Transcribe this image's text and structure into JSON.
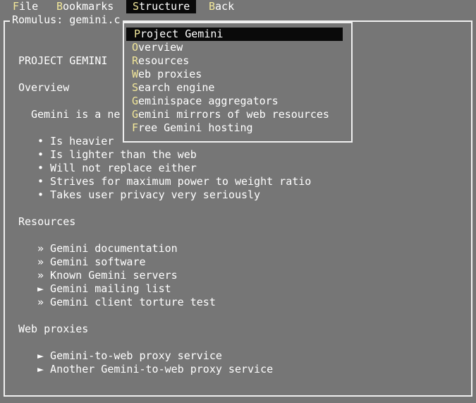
{
  "menubar": [
    {
      "label": "File",
      "hotkey": "F",
      "rest": "ile",
      "active": false
    },
    {
      "label": "Bookmarks",
      "hotkey": "B",
      "rest": "ookmarks",
      "active": false
    },
    {
      "label": "Structure",
      "hotkey": "S",
      "rest": "tructure",
      "active": true
    },
    {
      "label": "Back",
      "hotkey": "B",
      "rest": "ack",
      "active": false
    }
  ],
  "window": {
    "title": "Romulus: gemini.c"
  },
  "content": {
    "heading": "PROJECT GEMINI",
    "section_overview": "Overview",
    "intro": "Gemini is a ne",
    "overview_bullets": [
      "• Is heavier",
      "• Is lighter than the web",
      "• Will not replace either",
      "• Strives for maximum power to weight ratio",
      "• Takes user privacy very seriously"
    ],
    "section_resources": "Resources",
    "resource_links": [
      "» Gemini documentation",
      "» Gemini software",
      "» Known Gemini servers",
      "► Gemini mailing list",
      "» Gemini client torture test"
    ],
    "section_proxies": "Web proxies",
    "proxy_links": [
      "► Gemini-to-web proxy service",
      "► Another Gemini-to-web proxy service"
    ]
  },
  "structure_menu": {
    "items": [
      {
        "hotkey": "P",
        "rest": "roject Gemini",
        "selected": true
      },
      {
        "hotkey": "O",
        "rest": "verview",
        "selected": false
      },
      {
        "hotkey": "R",
        "rest": "esources",
        "selected": false
      },
      {
        "hotkey": "W",
        "rest": "eb proxies",
        "selected": false
      },
      {
        "hotkey": "S",
        "rest": "earch engine",
        "selected": false
      },
      {
        "hotkey": "G",
        "rest": "eminispace aggregators",
        "selected": false
      },
      {
        "hotkey": "G",
        "rest": "emini mirrors of web resources",
        "selected": false
      },
      {
        "hotkey": "F",
        "rest": "ree Gemini hosting",
        "selected": false
      }
    ]
  },
  "colors": {
    "background": "#767676",
    "highlight": "#0a0a0a",
    "hotkey": "#f2e79a",
    "text": "#ffffff"
  }
}
